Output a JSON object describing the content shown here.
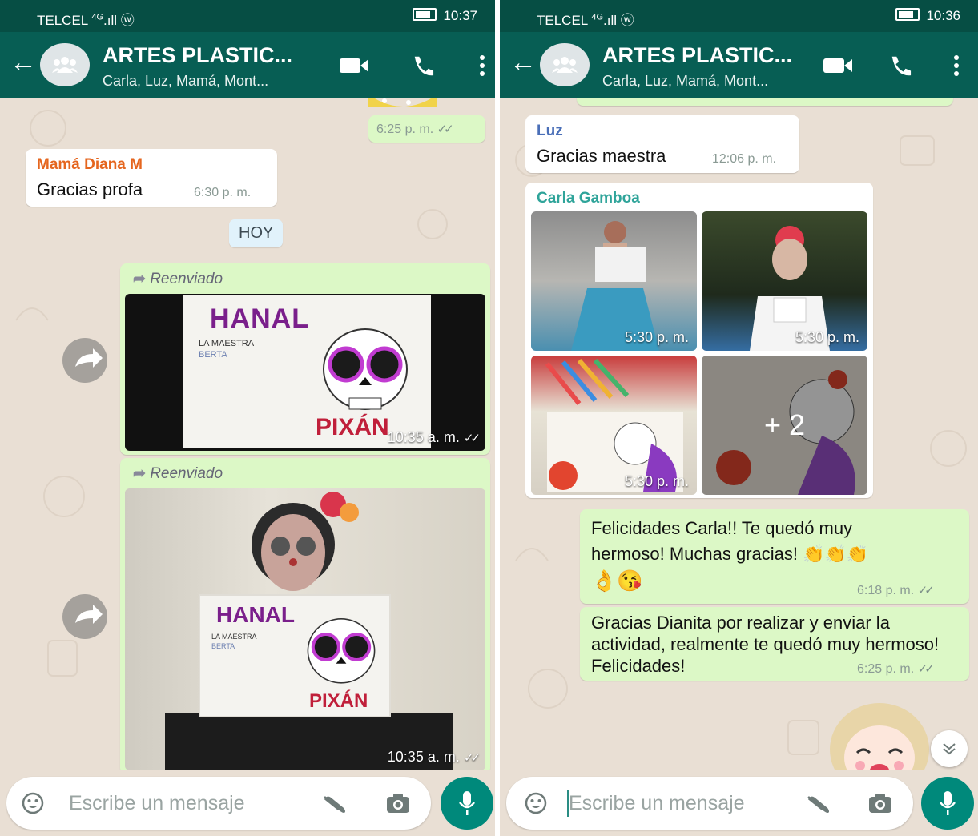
{
  "left": {
    "status": {
      "carrier": "TELCEL",
      "signal": "4G",
      "time": "10:37"
    },
    "header": {
      "title": "ARTES PLASTIC...",
      "subtitle": "Carla, Luz, Mamá, Mont..."
    },
    "messages": {
      "m1_time": "6:25 p. m.",
      "m2_sender": "Mamá Diana M",
      "m2_text": "Gracias profa",
      "m2_time": "6:30 p. m.",
      "date_badge": "HOY",
      "m3_forwarded": "Reenviado",
      "m3_time": "10:35 a. m.",
      "m4_forwarded": "Reenviado",
      "m4_time": "10:35 a. m."
    },
    "poster": {
      "title": "HANAL",
      "teacher": "LA MAESTRA",
      "name": "BERTA",
      "footer": "PIXÁN"
    },
    "input": {
      "placeholder": "Escribe un mensaje"
    }
  },
  "right": {
    "status": {
      "carrier": "TELCEL",
      "signal": "4G",
      "time": "10:36"
    },
    "header": {
      "title": "ARTES PLASTIC...",
      "subtitle": "Carla, Luz, Mamá, Mont..."
    },
    "messages": {
      "m1_sender": "Luz",
      "m1_text": "Gracias maestra",
      "m1_time": "12:06 p. m.",
      "m2_sender": "Carla Gamboa",
      "album_times": [
        "5:30 p. m.",
        "5:30 p. m.",
        "5:30 p. m."
      ],
      "album_more": "+ 2",
      "m3_text": "Felicidades Carla!! Te quedó muy hermoso! Muchas gracias!",
      "m3_emoji": "👏👏👏",
      "m3_emoji2": "👌😘",
      "m3_time": "6:18 p. m.",
      "m4_text": "Gracias Dianita por realizar y enviar la actividad, realmente te quedó muy hermoso! Felicidades!",
      "m4_time": "6:25 p. m."
    },
    "input": {
      "placeholder": "Escribe un mensaje"
    }
  },
  "colors": {
    "header": "#075e54",
    "status": "#064e44",
    "outgoing": "#dcf8c6",
    "incoming": "#ffffff",
    "mic": "#00897b",
    "chat_bg": "#e9dfd4"
  }
}
